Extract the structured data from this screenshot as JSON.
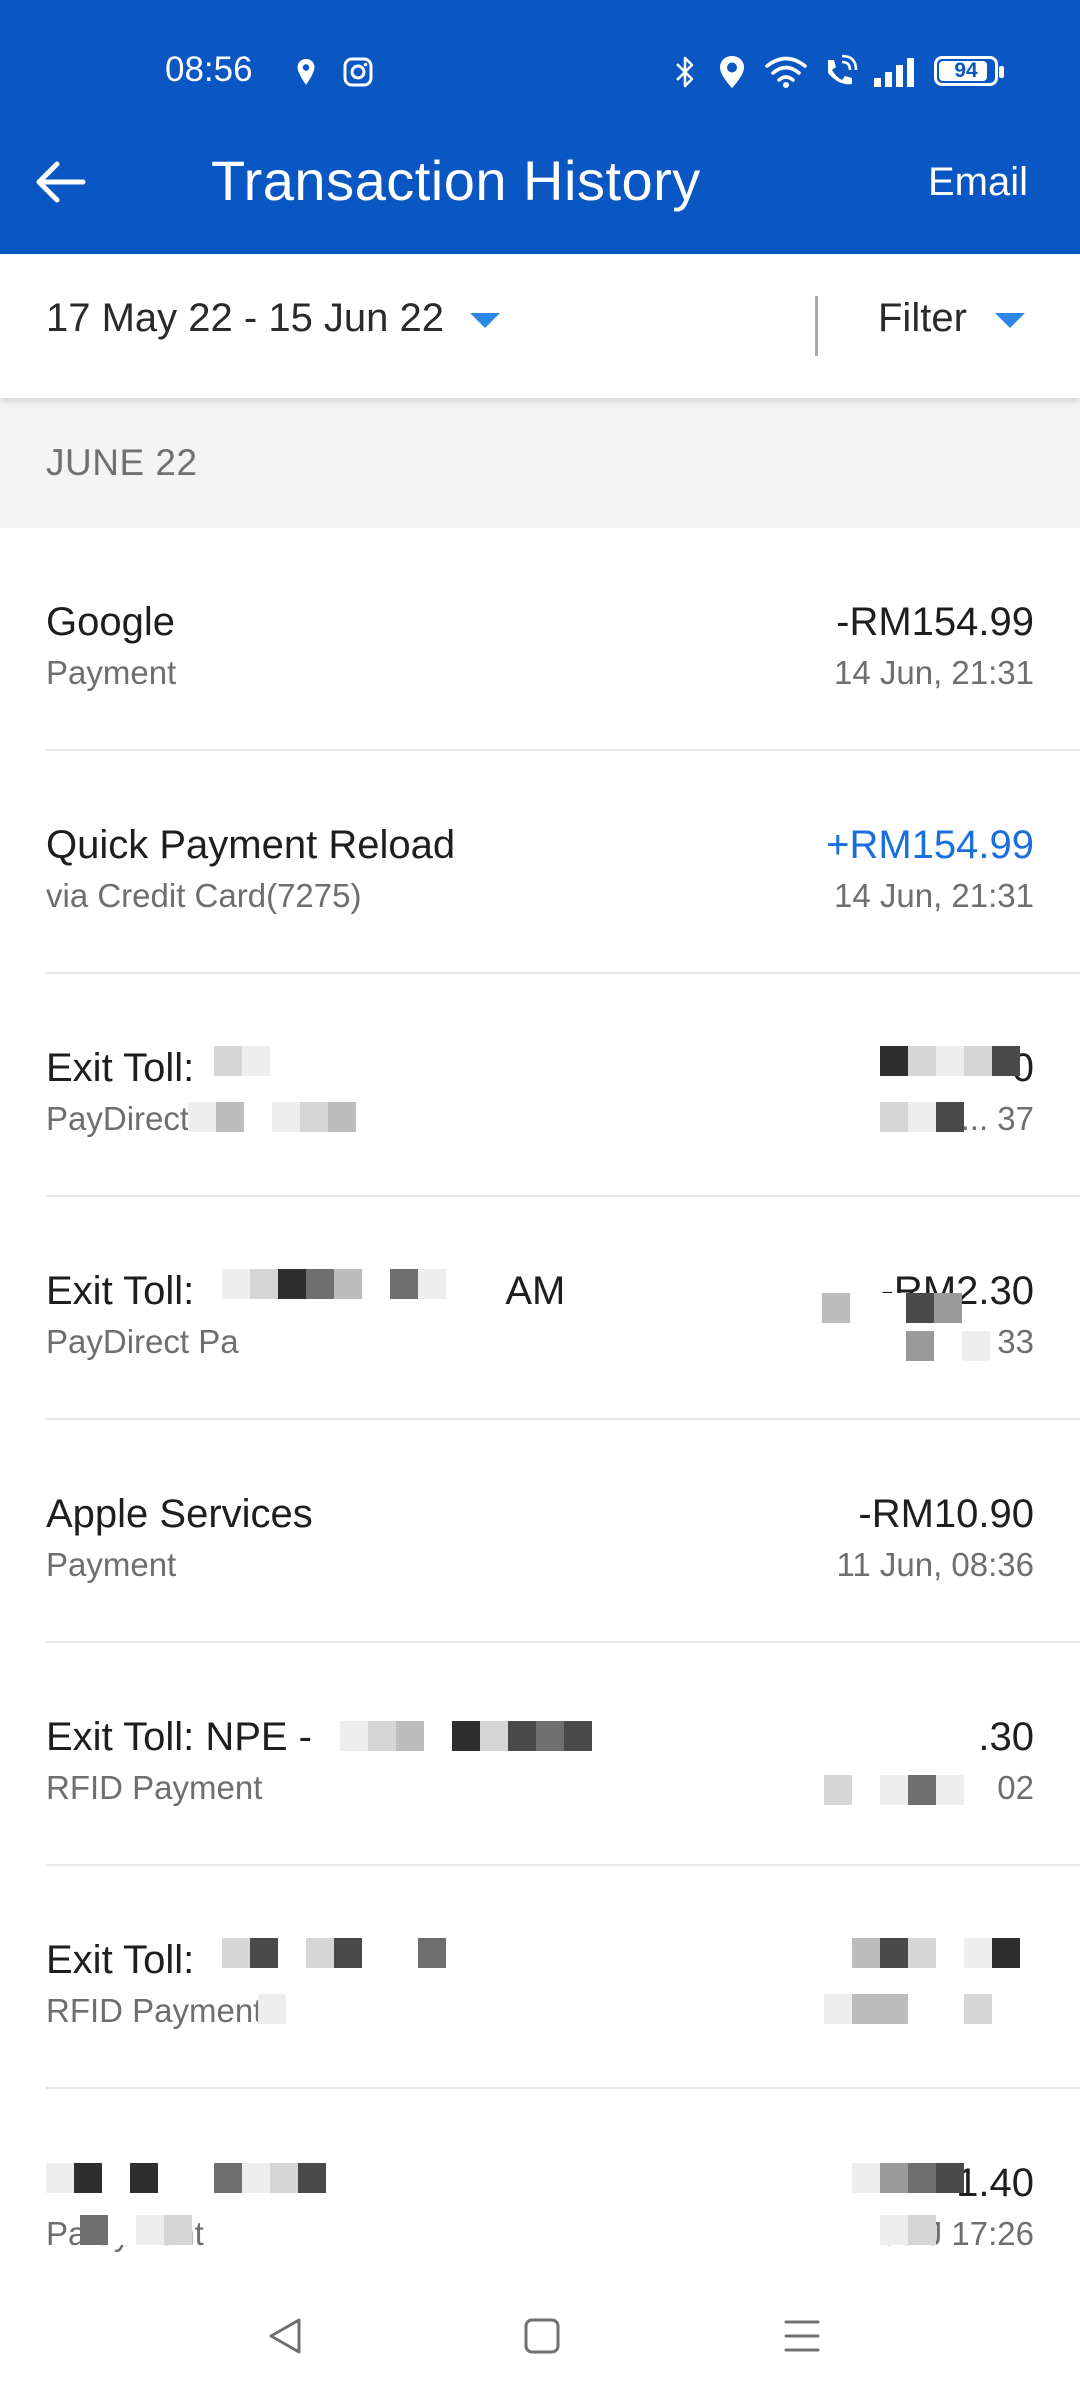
{
  "status_bar": {
    "time": "08:56",
    "battery": "94",
    "icons": [
      "location-pin-icon",
      "instagram-icon",
      "bluetooth-icon",
      "location-icon",
      "wifi-icon",
      "wifi-calling-icon",
      "signal-icon",
      "battery-icon"
    ]
  },
  "header": {
    "title": "Transaction History",
    "email_label": "Email",
    "back_icon": "arrow-left-icon",
    "color": "#0a56c2"
  },
  "filters": {
    "date_range": "17 May 22 - 15 Jun 22",
    "filter_label": "Filter",
    "caret_color": "#2b86e6"
  },
  "section": {
    "label": "JUNE 22"
  },
  "transactions": [
    {
      "name": "Google",
      "sub": "Payment",
      "amount": "-RM154.99",
      "date": "14 Jun, 21:31"
    },
    {
      "name": "Quick Payment Reload",
      "sub": "via Credit Card(7275)",
      "amount": "+RM154.99",
      "date": "14 Jun, 21:31",
      "credit_color": "#1a6fe0"
    },
    {
      "name": "Exit Toll: ",
      "sub": "PayDirect",
      "amount": "0",
      "date": "12 ... 37"
    },
    {
      "name": "Exit Toll: ",
      "name_suffix": "AM",
      "sub": "PayDirect Pa",
      "amount": "-RM2.30",
      "date": "33"
    },
    {
      "name": "Apple Services",
      "sub": "Payment",
      "amount": "-RM10.90",
      "date": "11 Jun, 08:36"
    },
    {
      "name": "Exit Toll: NPE - ",
      "sub": "RFID Payment",
      "amount": ".30",
      "date": "02"
    },
    {
      "name": "Exit Toll: ",
      "sub": "RFID Payment",
      "amount": "",
      "date": ""
    },
    {
      "name": "",
      "sub": "Pa      ayment",
      "amount": "1.40",
      "date": "03 J   17:26"
    }
  ],
  "nav": {
    "back_icon": "nav-back-icon",
    "home_icon": "nav-home-icon",
    "menu_icon": "nav-menu-icon"
  }
}
